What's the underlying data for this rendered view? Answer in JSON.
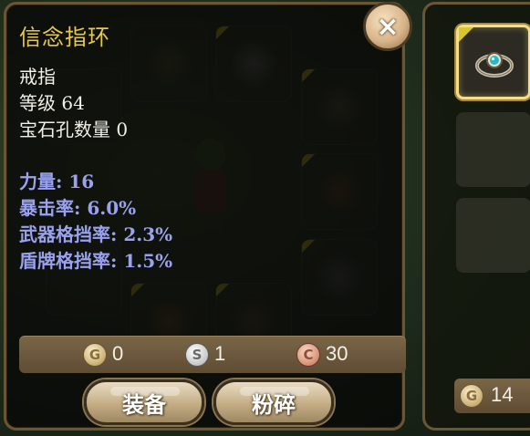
{
  "tooltip": {
    "title": "信念指环",
    "type": "戒指",
    "level": "等级 64",
    "gem_slots": "宝石孔数量 0",
    "stats": [
      {
        "text": "力量: 16"
      },
      {
        "text": "暴击率: 6.0%"
      },
      {
        "text": "武器格挡率: 2.3%"
      },
      {
        "text": "盾牌格挡率: 1.5%"
      }
    ],
    "price": {
      "gold": {
        "symbol": "G",
        "amount": "0"
      },
      "silver": {
        "symbol": "S",
        "amount": "1"
      },
      "copper": {
        "symbol": "C",
        "amount": "30"
      }
    },
    "buttons": {
      "equip": "装备",
      "smash": "粉碎"
    },
    "close_icon": "×"
  },
  "right_panel": {
    "selected_item_icon": "ring-icon",
    "price": {
      "symbol": "G",
      "amount": "14"
    }
  },
  "colors": {
    "title": "#e9c844",
    "stat": "#9aa2f0",
    "text": "#f1efe6"
  }
}
